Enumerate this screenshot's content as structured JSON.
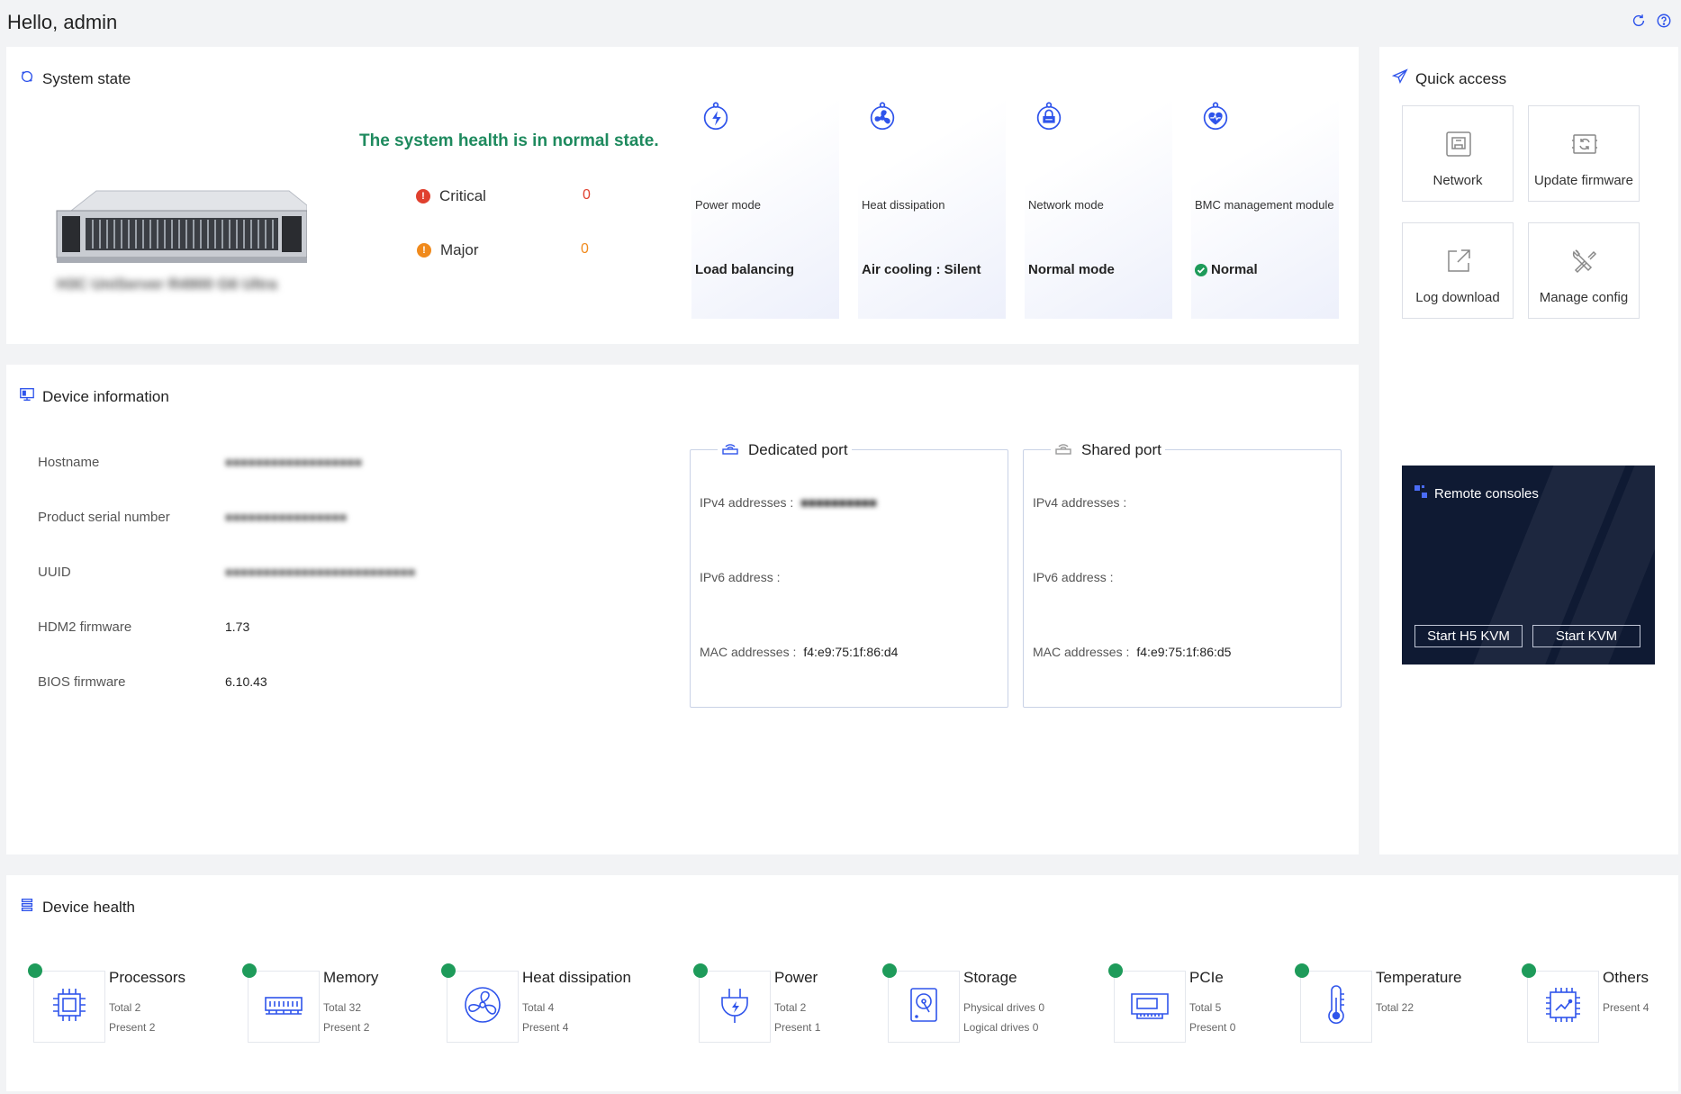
{
  "header": {
    "greeting": "Hello, admin"
  },
  "system_state": {
    "title": "System state",
    "health_message": "The system health is in normal state.",
    "alarms": [
      {
        "label": "Critical",
        "count": "0",
        "color": "#e0402e"
      },
      {
        "label": "Major",
        "count": "0",
        "color": "#f08a1c"
      }
    ],
    "cards": [
      {
        "label": "Power mode",
        "value": "Load balancing"
      },
      {
        "label": "Heat dissipation",
        "value": "Air cooling : Silent"
      },
      {
        "label": "Network mode",
        "value": "Normal mode"
      },
      {
        "label": "BMC management module",
        "value": "Normal"
      }
    ]
  },
  "quick_access": {
    "title": "Quick access",
    "buttons": [
      {
        "label": "Network"
      },
      {
        "label": "Update firmware"
      },
      {
        "label": "Log download"
      },
      {
        "label": "Manage config"
      }
    ],
    "remote": {
      "title": "Remote consoles",
      "h5_label": "Start H5 KVM",
      "kvm_label": "Start KVM"
    }
  },
  "device_info": {
    "title": "Device information",
    "rows": [
      {
        "label": "Hostname",
        "value": ""
      },
      {
        "label": "Product serial number",
        "value": ""
      },
      {
        "label": "UUID",
        "value": ""
      },
      {
        "label": "HDM2 firmware",
        "value": "1.73"
      },
      {
        "label": "BIOS firmware",
        "value": "6.10.43"
      }
    ],
    "dedicated_port": {
      "title": "Dedicated port",
      "ipv4_label": "IPv4 addresses :",
      "ipv4_value": "",
      "ipv6_label": "IPv6 address :",
      "ipv6_value": "",
      "mac_label": "MAC addresses :",
      "mac_value": "f4:e9:75:1f:86:d4"
    },
    "shared_port": {
      "title": "Shared port",
      "ipv4_label": "IPv4 addresses :",
      "ipv4_value": "",
      "ipv6_label": "IPv6 address :",
      "ipv6_value": "",
      "mac_label": "MAC addresses :",
      "mac_value": "f4:e9:75:1f:86:d5"
    }
  },
  "device_health": {
    "title": "Device health",
    "items": [
      {
        "name": "Processors",
        "line1": "Total 2",
        "line2": "Present 2"
      },
      {
        "name": "Memory",
        "line1": "Total 32",
        "line2": "Present 2"
      },
      {
        "name": "Heat dissipation",
        "line1": "Total 4",
        "line2": "Present 4"
      },
      {
        "name": "Power",
        "line1": "Total 2",
        "line2": "Present 1"
      },
      {
        "name": "Storage",
        "line1": "Physical drives 0",
        "line2": "Logical drives 0"
      },
      {
        "name": "PCIe",
        "line1": "Total 5",
        "line2": "Present 0"
      },
      {
        "name": "Temperature",
        "line1": "Total 22",
        "line2": ""
      },
      {
        "name": "Others",
        "line1": "Present 4",
        "line2": ""
      }
    ]
  },
  "colors": {
    "accent": "#2f54eb",
    "ok": "#1e9b5a",
    "health_text": "#1e8a5e"
  }
}
